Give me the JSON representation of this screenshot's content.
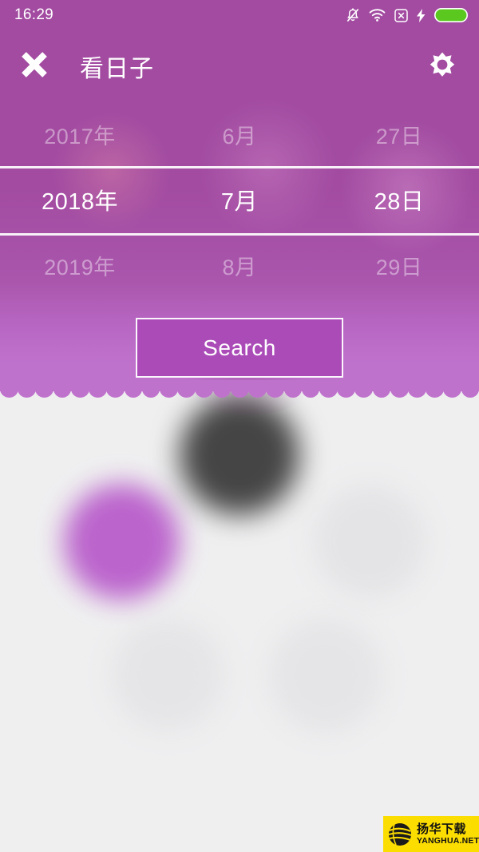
{
  "status_bar": {
    "time": "16:29",
    "icons": [
      "bell-mute-icon",
      "wifi-icon",
      "x-box-icon",
      "charging-bolt-icon",
      "battery-icon"
    ],
    "battery_color": "#5ac81e"
  },
  "header": {
    "close_icon": "close-icon",
    "title": "看日子",
    "settings_icon": "gear-icon"
  },
  "picker": {
    "columns": [
      "year",
      "month",
      "day"
    ],
    "previous_row": {
      "year": "2017年",
      "month": "6月",
      "day": "27日"
    },
    "selected_row": {
      "year": "2018年",
      "month": "7月",
      "day": "28日"
    },
    "next_row": {
      "year": "2019年",
      "month": "8月",
      "day": "29日"
    }
  },
  "actions": {
    "search_label": "Search"
  },
  "theme": {
    "panel_top": "#a24ba1",
    "panel_bottom": "#bf72cc",
    "button_fill": "#ab4bb8",
    "page_background": "#efeff0"
  },
  "watermark": {
    "cn": "扬华下载",
    "en": "YANGHUA.NET"
  }
}
